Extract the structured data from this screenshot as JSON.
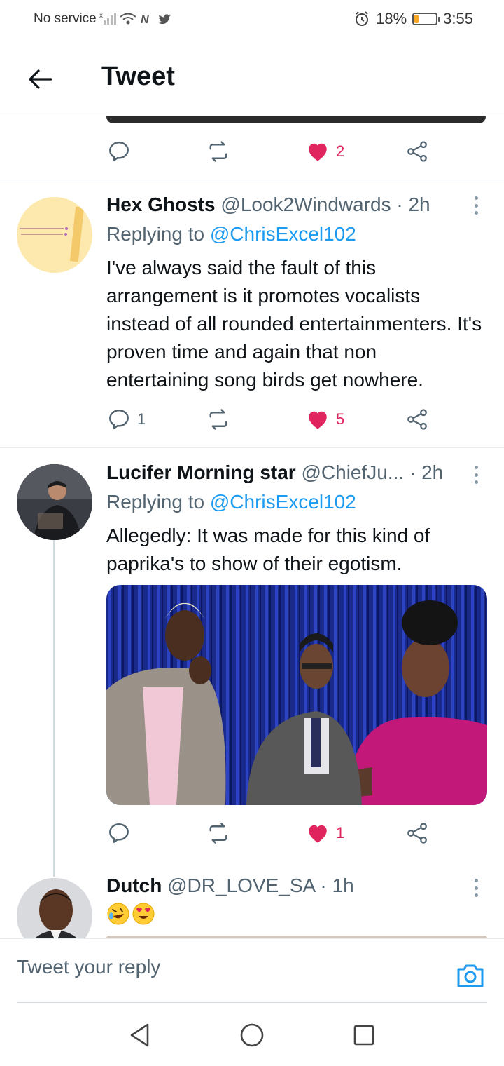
{
  "status_bar": {
    "carrier": "No service",
    "battery_percent": "18%",
    "battery_level": 0.18,
    "time": "3:55"
  },
  "header": {
    "title": "Tweet"
  },
  "top_tweet": {
    "reply_count": "",
    "retweet_count": "",
    "like_count": "2"
  },
  "tweets": [
    {
      "name": "Hex Ghosts",
      "handle": "@Look2Windwards",
      "time": "2h",
      "replying_prefix": "Replying to",
      "replying_to": "@ChrisExcel102",
      "text": "I've always said the fault of this arrangement is it promotes vocalists instead of all rounded entertainmenters. It's proven time and again that non entertaining song birds get nowhere.",
      "reply_count": "1",
      "retweet_count": "",
      "like_count": "5"
    },
    {
      "name": "Lucifer Morning star",
      "handle": "@ChiefJu...",
      "time": "2h",
      "replying_prefix": "Replying to",
      "replying_to": "@ChrisExcel102",
      "text": "Allegedly: It was made for this kind of paprika's to show of their egotism.",
      "reply_count": "",
      "retweet_count": "",
      "like_count": "1"
    },
    {
      "name": "Dutch",
      "handle": "@DR_LOVE_SA",
      "time": "1h",
      "emojis": [
        "rolling-on-floor-laughing-emoji",
        "heart-eyes-emoji"
      ]
    }
  ],
  "separator": "·",
  "reply_bar": {
    "placeholder": "Tweet your reply"
  },
  "colors": {
    "accent": "#1d9bf0",
    "like": "#e0245e",
    "muted": "#536471",
    "divider": "#e6ecf0"
  }
}
